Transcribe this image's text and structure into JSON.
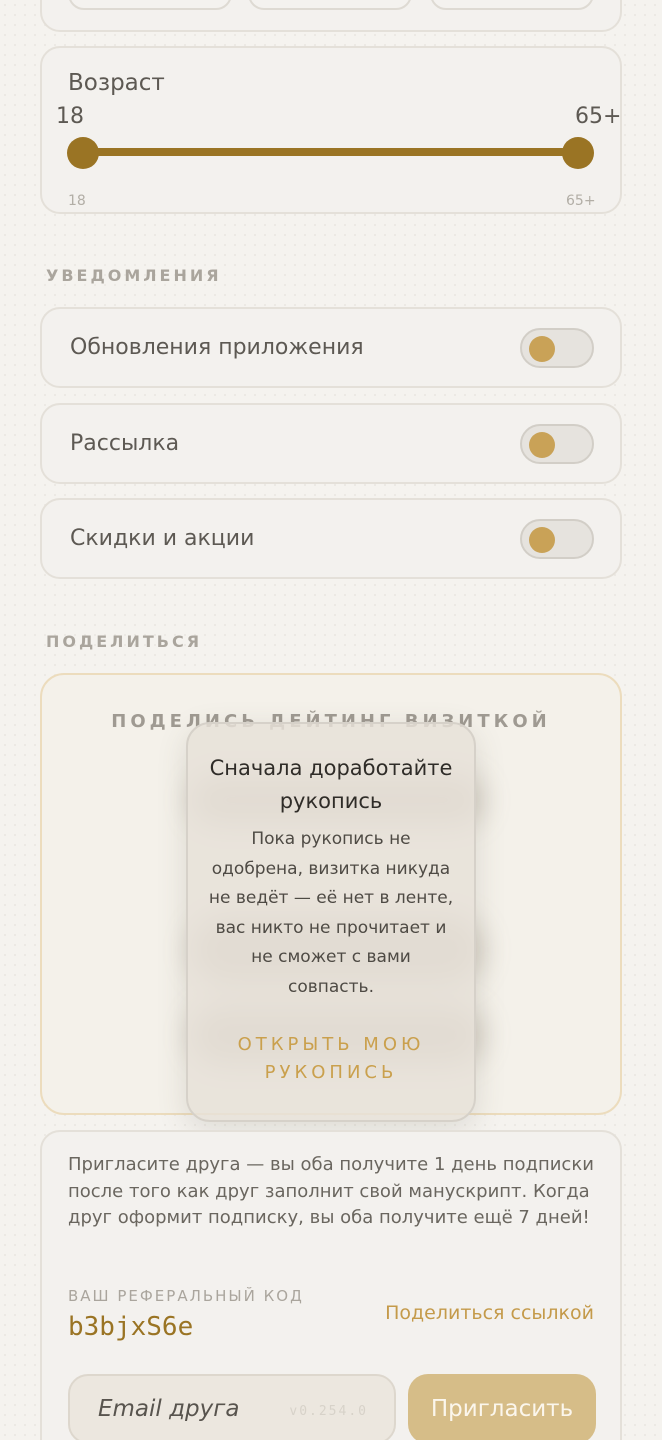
{
  "age": {
    "title": "Возраст",
    "min_value": "18",
    "max_value": "65+",
    "scale_min": "18",
    "scale_max": "65+"
  },
  "notifications": {
    "section_label": "УВЕДОМЛЕНИЯ",
    "items": [
      {
        "label": "Обновления приложения",
        "enabled": false
      },
      {
        "label": "Рассылка",
        "enabled": false
      },
      {
        "label": "Скидки и акции",
        "enabled": false
      }
    ]
  },
  "share": {
    "section_label": "ПОДЕЛИТЬСЯ",
    "heading": "ПОДЕЛИСЬ ДЕЙТИНГ ВИЗИТКОЙ"
  },
  "modal": {
    "title": "Сначала доработайте рукопись",
    "body": "Пока рукопись не одобрена, визитка никуда не ведёт — её нет в ленте, вас никто не прочитает и не сможет с вами совпасть.",
    "cta": "ОТКРЫТЬ МОЮ РУКОПИСЬ"
  },
  "referral": {
    "description": "Пригласите друга — вы оба получите 1 день подписки после того как друг заполнит свой манускрипт. Когда друг оформит подписку, вы оба получите ещё 7 дней!",
    "code_label": "ВАШ РЕФЕРАЛЬНЫЙ КОД",
    "code": "b3bjxS6e",
    "share_link": "Поделиться ссылкой",
    "email_placeholder": "Email друга",
    "invite_button": "Пригласить"
  },
  "version": "v0.254.0",
  "colors": {
    "accent": "#9a7424",
    "gold": "#c9a257",
    "background": "#f5f3ef"
  }
}
